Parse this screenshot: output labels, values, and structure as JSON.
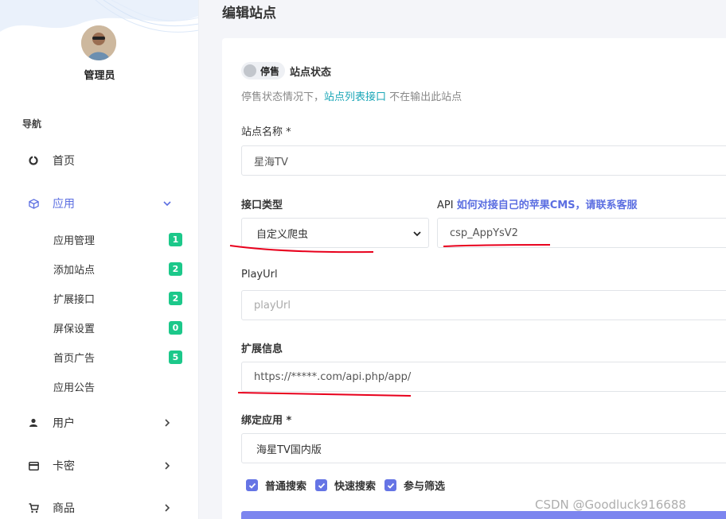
{
  "sidebar": {
    "admin_name": "管理员",
    "nav_title": "导航",
    "items": [
      {
        "label": "首页",
        "icon": "dashboard-icon"
      },
      {
        "label": "应用",
        "icon": "cube-icon"
      },
      {
        "label": "用户",
        "icon": "user-icon"
      },
      {
        "label": "卡密",
        "icon": "card-icon"
      },
      {
        "label": "商品",
        "icon": "cart-icon"
      }
    ],
    "sub_items": [
      {
        "label": "应用管理",
        "badge": "1"
      },
      {
        "label": "添加站点",
        "badge": "2"
      },
      {
        "label": "扩展接口",
        "badge": "2"
      },
      {
        "label": "屏保设置",
        "badge": "0"
      },
      {
        "label": "首页广告",
        "badge": "5"
      },
      {
        "label": "应用公告",
        "badge": ""
      }
    ]
  },
  "page": {
    "title": "编辑站点"
  },
  "form": {
    "status_toggle_text": "停售",
    "status_label": "站点状态",
    "hint_prefix": "停售状态情况下，",
    "hint_link": "站点列表接口",
    "hint_suffix": " 不在输出此站点",
    "site_name_label": "站点名称 *",
    "site_name_value": "星海TV",
    "api_type_label": "接口类型",
    "api_type_value": "自定义爬虫",
    "api_label_prefix": "API ",
    "api_label_link": "如何对接自己的苹果CMS，请联系客服",
    "api_value": "csp_AppYsV2",
    "playurl_label": "PlayUrl",
    "playurl_placeholder": "playUrl",
    "ext_label": "扩展信息",
    "ext_value": "https://*****.com/api.php/app/",
    "bind_app_label": "绑定应用 *",
    "bind_app_value": "海星TV国内版",
    "checkboxes": [
      {
        "label": "普通搜索",
        "checked": true
      },
      {
        "label": "快速搜索",
        "checked": true
      },
      {
        "label": "参与筛选",
        "checked": true
      }
    ]
  },
  "watermark": "CSDN @Goodluck916688",
  "colors": {
    "accent": "#5b6ee1",
    "badge": "#1cc88a",
    "link": "#1aa6b7",
    "annotation": "#e8001c"
  }
}
